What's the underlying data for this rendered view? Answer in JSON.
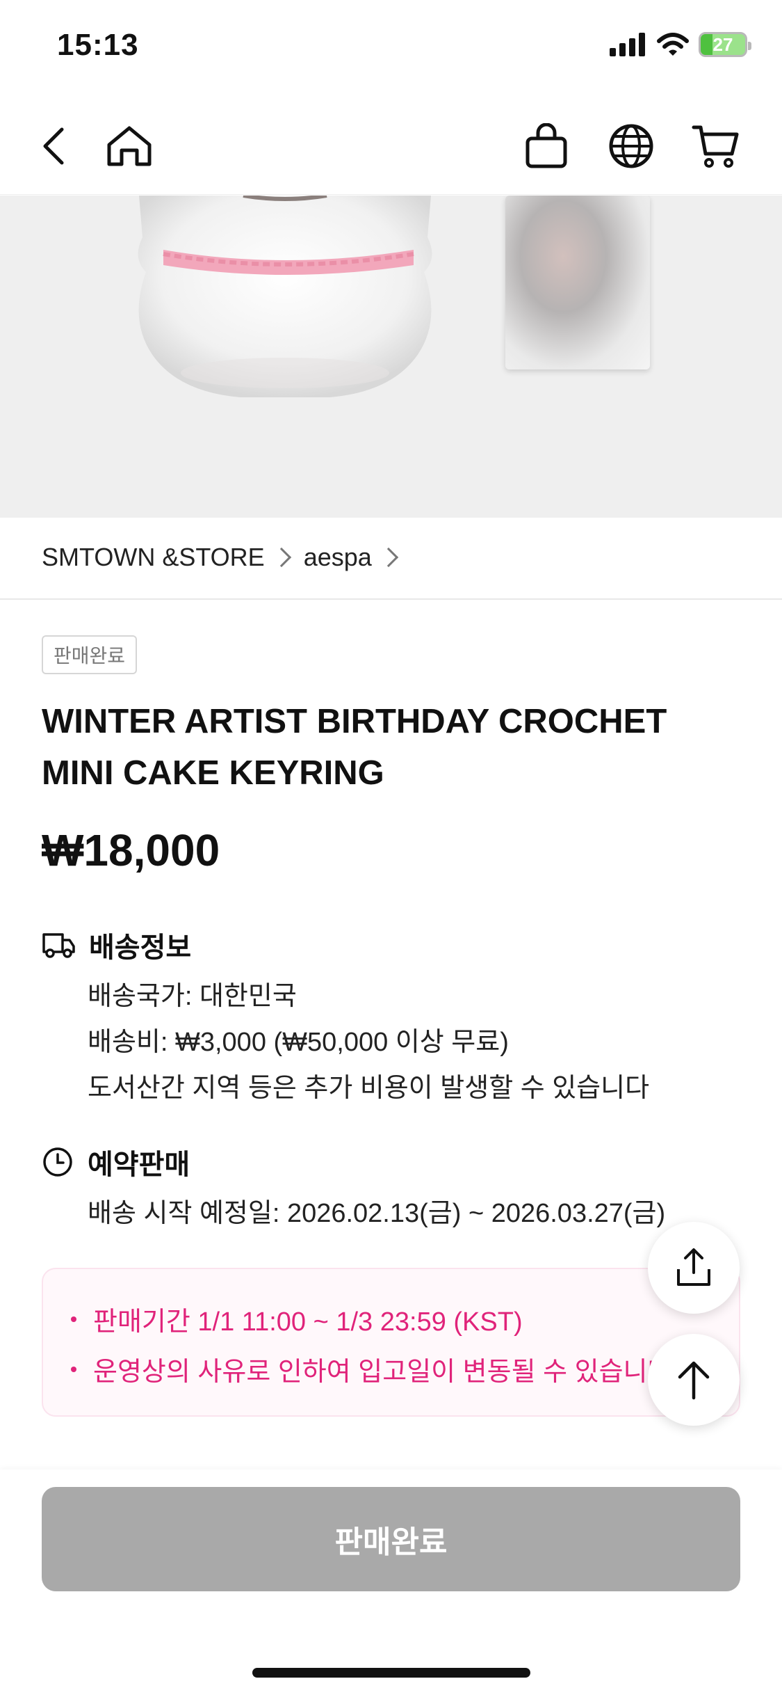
{
  "status_bar": {
    "time": "15:13",
    "battery": "27",
    "battery_level": 0.27
  },
  "breadcrumb": {
    "store": "SMTOWN &STORE",
    "artist": "aespa"
  },
  "product": {
    "badge": "판매완료",
    "title": "WINTER ARTIST BIRTHDAY CROCHET MINI CAKE KEYRING",
    "price": "₩18,000"
  },
  "shipping": {
    "heading": "배송정보",
    "country": "배송국가: 대한민국",
    "fee": "배송비: ₩3,000 (₩50,000 이상 무료)",
    "note": "도서산간 지역 등은 추가 비용이 발생할 수 있습니다"
  },
  "preorder": {
    "heading": "예약판매",
    "ship_date": "배송 시작 예정일: 2026.02.13(금) ~ 2026.03.27(금)"
  },
  "notice": {
    "items": [
      "판매기간 1/1 11:00 ~ 1/3 23:59 (KST)",
      "운영상의 사유로 인하여 입고일이 변동될 수 있습니다"
    ]
  },
  "bottom": {
    "button_label": "판매완료"
  },
  "icons": {
    "back": "chevron-left-icon",
    "home": "home-icon",
    "bag": "shopping-bag-icon",
    "globe": "globe-icon",
    "cart": "cart-icon",
    "truck": "truck-icon",
    "clock": "clock-icon",
    "share": "share-icon",
    "top": "arrow-up-icon"
  },
  "colors": {
    "accent_pink": "#e0237a",
    "disabled_gray": "#a9a9a9"
  }
}
